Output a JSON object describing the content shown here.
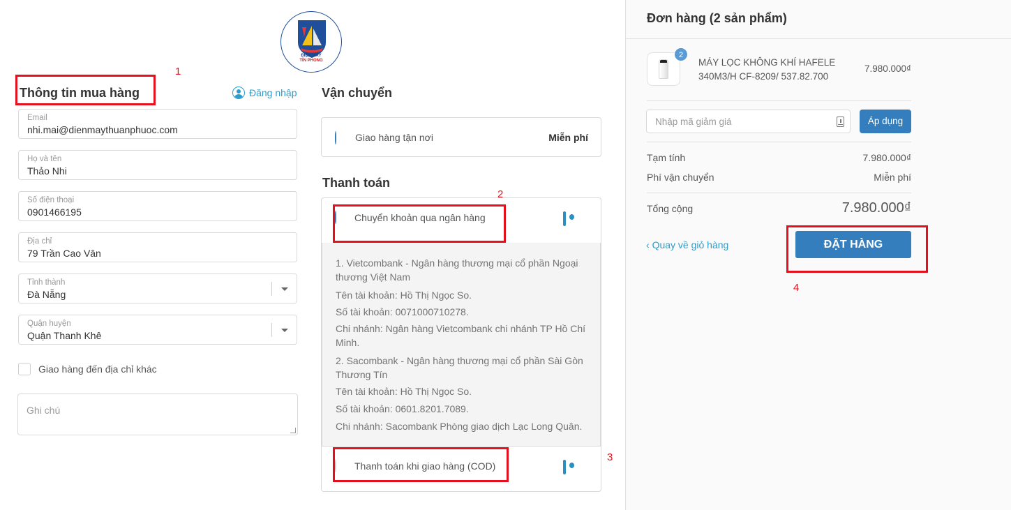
{
  "logo": {
    "line1": "ĐIỆN MÁY",
    "line2": "TÍN PHONG"
  },
  "customer": {
    "title": "Thông tin mua hàng",
    "login_label": "Đăng nhập",
    "fields": [
      {
        "label": "Email",
        "value": "nhi.mai@dienmaythuanphuoc.com"
      },
      {
        "label": "Họ và tên",
        "value": "Thảo Nhi"
      },
      {
        "label": "Số điện thoại",
        "value": "0901466195"
      },
      {
        "label": "Địa chỉ",
        "value": "79 Trần Cao Vân"
      },
      {
        "label": "Tỉnh thành",
        "value": "Đà Nẵng"
      },
      {
        "label": "Quận huyện",
        "value": "Quận Thanh Khê"
      }
    ],
    "ship_other_label": "Giao hàng đến địa chỉ khác",
    "note_placeholder": "Ghi chú"
  },
  "shipping": {
    "title": "Vận chuyển",
    "option_label": "Giao hàng tận nơi",
    "option_price": "Miễn phí"
  },
  "payment": {
    "title": "Thanh toán",
    "options": [
      {
        "label": "Chuyển khoản qua ngân hàng",
        "icon": "money-bill-icon",
        "selected": true
      },
      {
        "label": "Thanh toán khi giao hàng (COD)",
        "icon": "money-bill-icon",
        "selected": false
      }
    ],
    "bank_details": [
      "1. Vietcombank - Ngân hàng thương mại cổ phần Ngoại thương Việt Nam",
      "Tên tài khoản: Hồ Thị Ngọc So.",
      "Số tài khoản: 0071000710278.",
      "Chi nhánh: Ngân hàng Vietcombank chi nhánh TP Hồ Chí Minh.",
      "2. Sacombank - Ngân hàng thương mại cổ phần Sài Gòn Thương Tín",
      "Tên tài khoản: Hồ Thị Ngọc So.",
      "Số tài khoản: 0601.8201.7089.",
      "Chi nhánh: Sacombank Phòng giao dịch Lạc Long Quân."
    ]
  },
  "annotations": [
    "1",
    "2",
    "3",
    "4"
  ],
  "order": {
    "title": "Đơn hàng (2 sản phẩm)",
    "item": {
      "quantity": "2",
      "name": "MÁY LỌC KHÔNG KHÍ HAFELE 340M3/H CF-8209/ 537.82.700",
      "price": "7.980.000₫"
    },
    "coupon_placeholder": "Nhập mã giảm giá",
    "apply_label": "Áp dụng",
    "subtotal_label": "Tạm tính",
    "subtotal_value": "7.980.000₫",
    "shipping_label": "Phí vận chuyển",
    "shipping_value": "Miễn phí",
    "total_label": "Tổng cộng",
    "total_value": "7.980.000₫",
    "back_label": "Quay về giỏ hàng",
    "place_order_label": "ĐẶT HÀNG"
  },
  "colors": {
    "accent": "#357ebd",
    "link": "#2a9dcc",
    "annotation": "#e5101e"
  }
}
